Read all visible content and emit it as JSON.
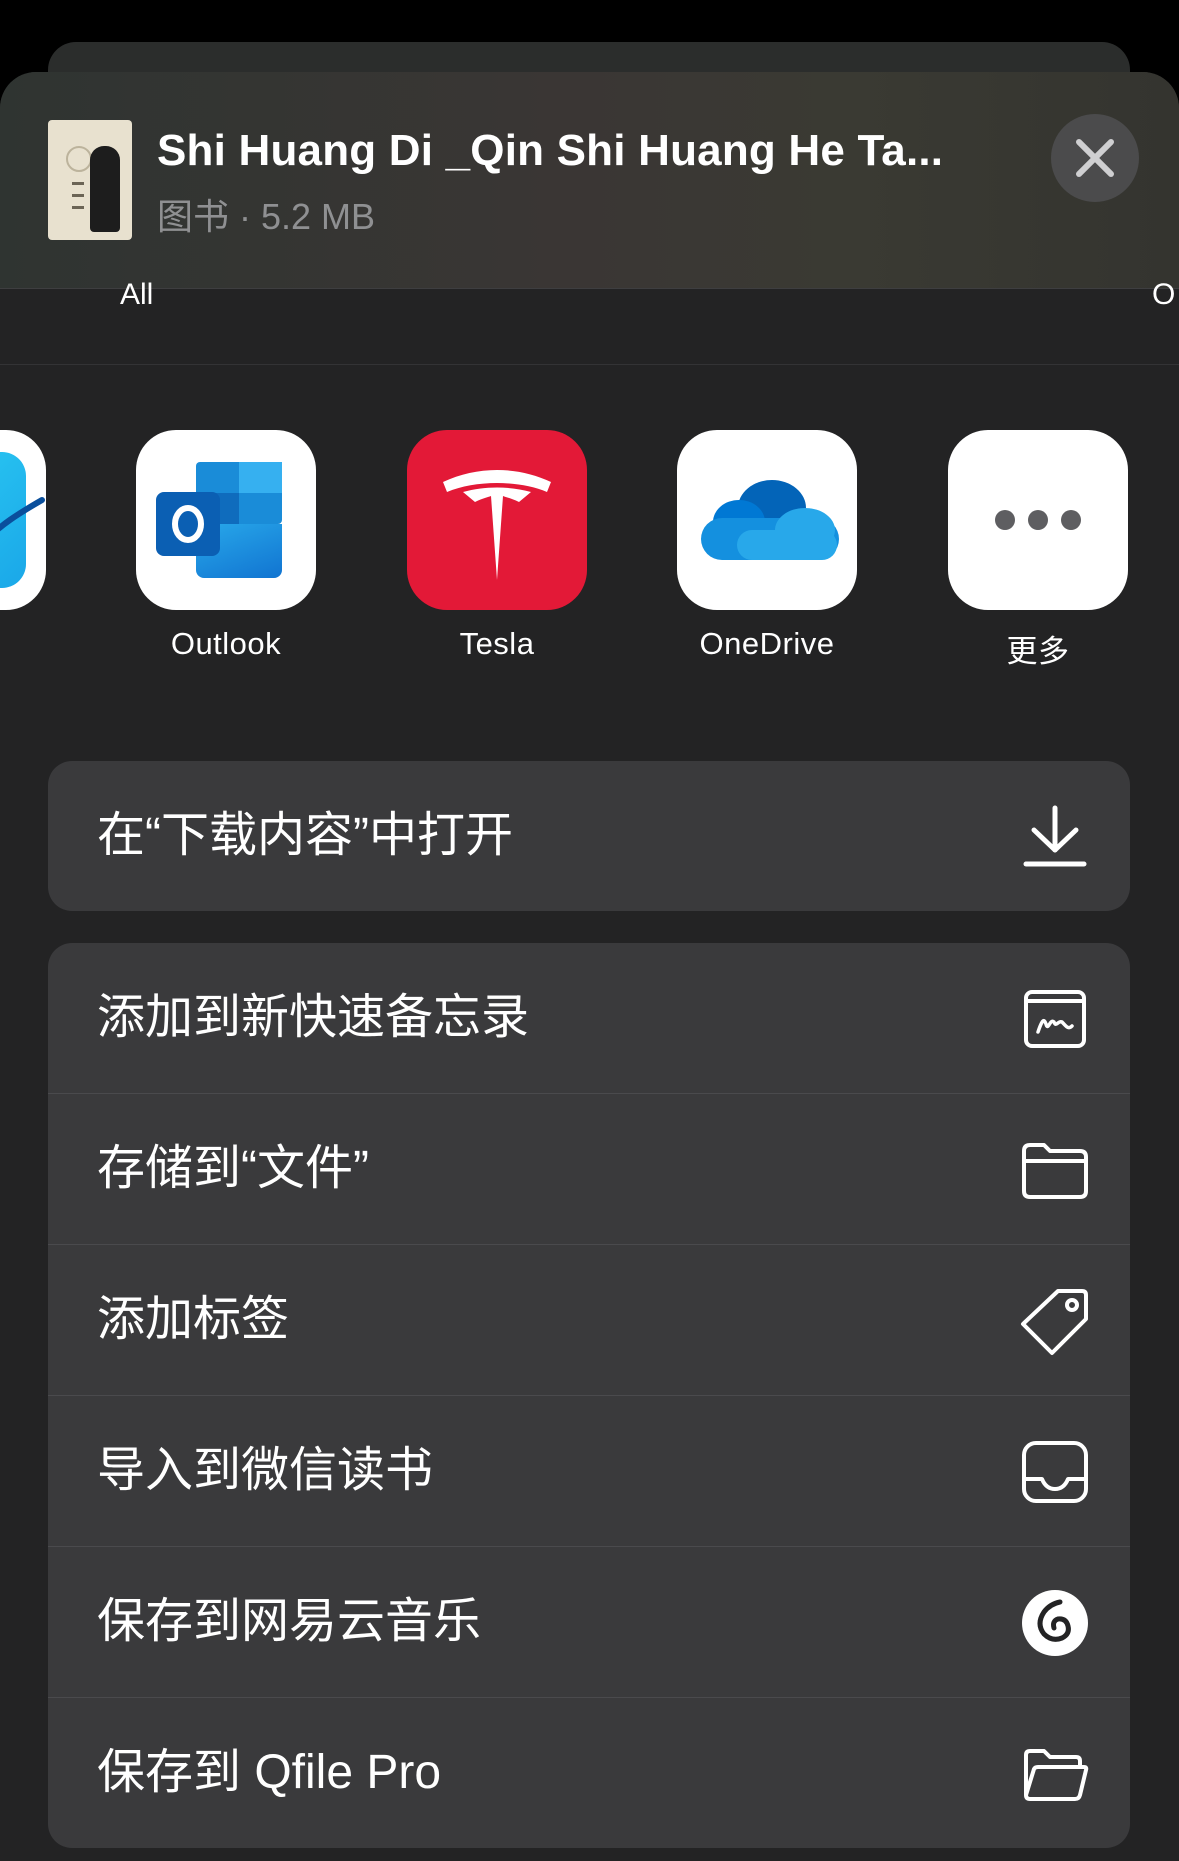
{
  "header": {
    "title": "Shi Huang Di _Qin Shi Huang He Ta...",
    "subtitle": "图书 · 5.2 MB",
    "close_icon": "close-icon",
    "thumbnail": {
      "lettering": [
        "始",
        "皇",
        "帝"
      ]
    }
  },
  "peek_row": {
    "left_text": "All",
    "right_text": "O"
  },
  "apps": [
    {
      "label": "",
      "icon": "freeform-app-icon"
    },
    {
      "label": "Outlook",
      "icon": "outlook-app-icon"
    },
    {
      "label": "Tesla",
      "icon": "tesla-app-icon"
    },
    {
      "label": "OneDrive",
      "icon": "onedrive-app-icon"
    },
    {
      "label": "更多",
      "icon": "more-icon"
    }
  ],
  "actions_group1": [
    {
      "label": "在“下载内容”中打开",
      "icon": "download-icon"
    }
  ],
  "actions_group2": [
    {
      "label": "添加到新快速备忘录",
      "icon": "quick-note-icon"
    },
    {
      "label": "存储到“文件”",
      "icon": "folder-icon"
    },
    {
      "label": "添加标签",
      "icon": "tag-icon"
    },
    {
      "label": "导入到微信读书",
      "icon": "tray-icon"
    },
    {
      "label": "保存到网易云音乐",
      "icon": "netease-music-icon"
    },
    {
      "label": "保存到 Qfile Pro",
      "icon": "open-folder-icon"
    }
  ],
  "colors": {
    "sheet_bg": "#232324",
    "row_bg": "#3a3a3c",
    "tesla_red": "#e31937",
    "outlook_blue": "#0f6cbd",
    "onedrive_blue": "#1490df"
  }
}
